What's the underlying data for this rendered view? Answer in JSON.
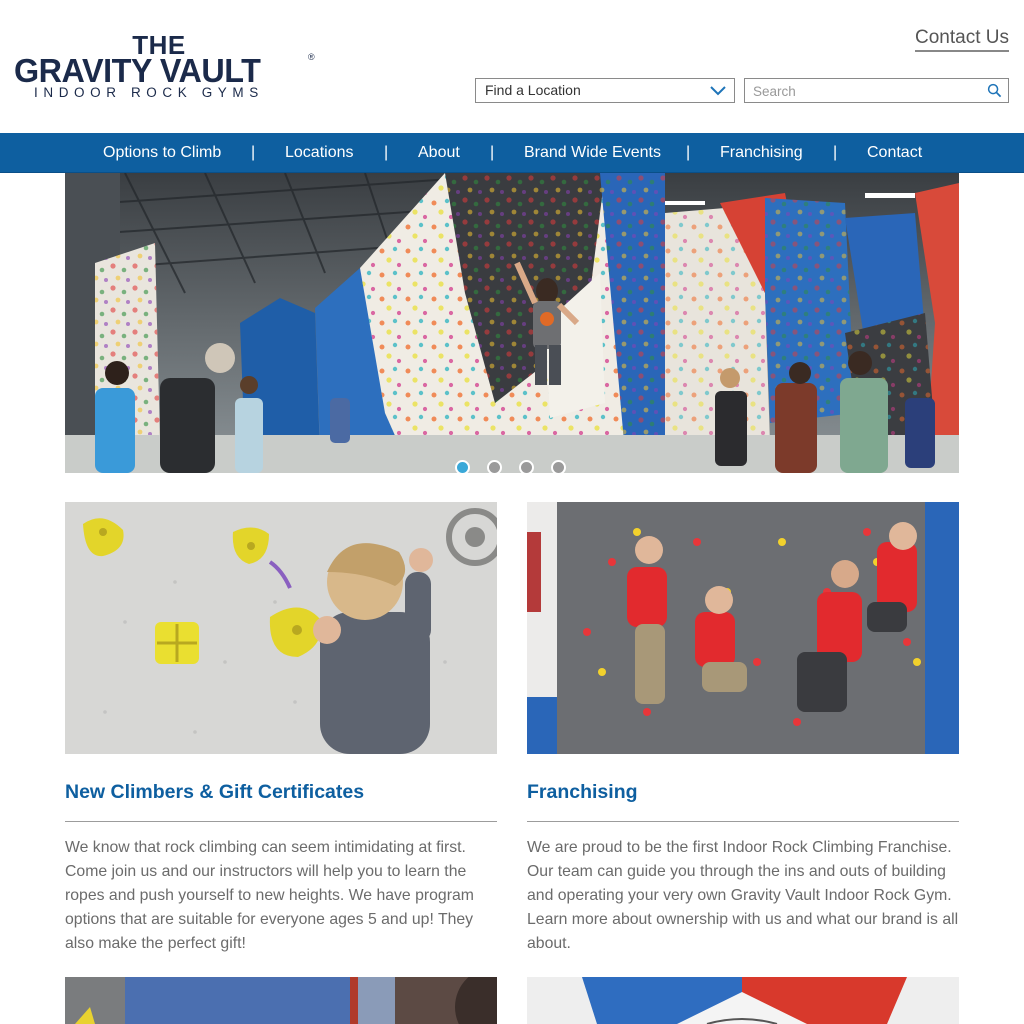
{
  "header": {
    "logo": {
      "line1": "THE",
      "line2": "GRAVITY VAULT",
      "registered": "®",
      "tagline": "INDOOR ROCK GYMS",
      "color": "#1b2a4a"
    },
    "contact_link": "Contact Us",
    "location_select": {
      "selected": "Find a Location",
      "icon": "chevron-down-icon"
    },
    "search": {
      "placeholder": "Search",
      "value": "",
      "icon": "search-icon"
    }
  },
  "nav": {
    "background": "#0e5fa0",
    "separator": "|",
    "items": [
      {
        "label": "Options to Climb"
      },
      {
        "label": "Locations"
      },
      {
        "label": "About"
      },
      {
        "label": "Brand Wide Events"
      },
      {
        "label": "Franchising"
      },
      {
        "label": "Contact"
      }
    ]
  },
  "hero": {
    "slide_count": 4,
    "active_slide": 1,
    "active_dot_color": "#3aa8d8"
  },
  "cards": [
    {
      "title": "New Climbers & Gift Certificates",
      "text": "We know that rock climbing can seem intimidating at first. Come join us and our instructors will help you to learn the ropes and push yourself to new heights. We have program options that are suitable for everyone ages 5 and up! They also make the perfect gift!"
    },
    {
      "title": "Franchising",
      "text": "We are proud to be the first Indoor Rock Climbing Franchise. Our team can guide you through the ins and outs of building and operating your very own Gravity Vault Indoor Rock Gym. Learn more about ownership with us and what our brand is all about."
    }
  ],
  "colors": {
    "accent": "#0e5fa0",
    "body_text": "#6b6b6b"
  }
}
